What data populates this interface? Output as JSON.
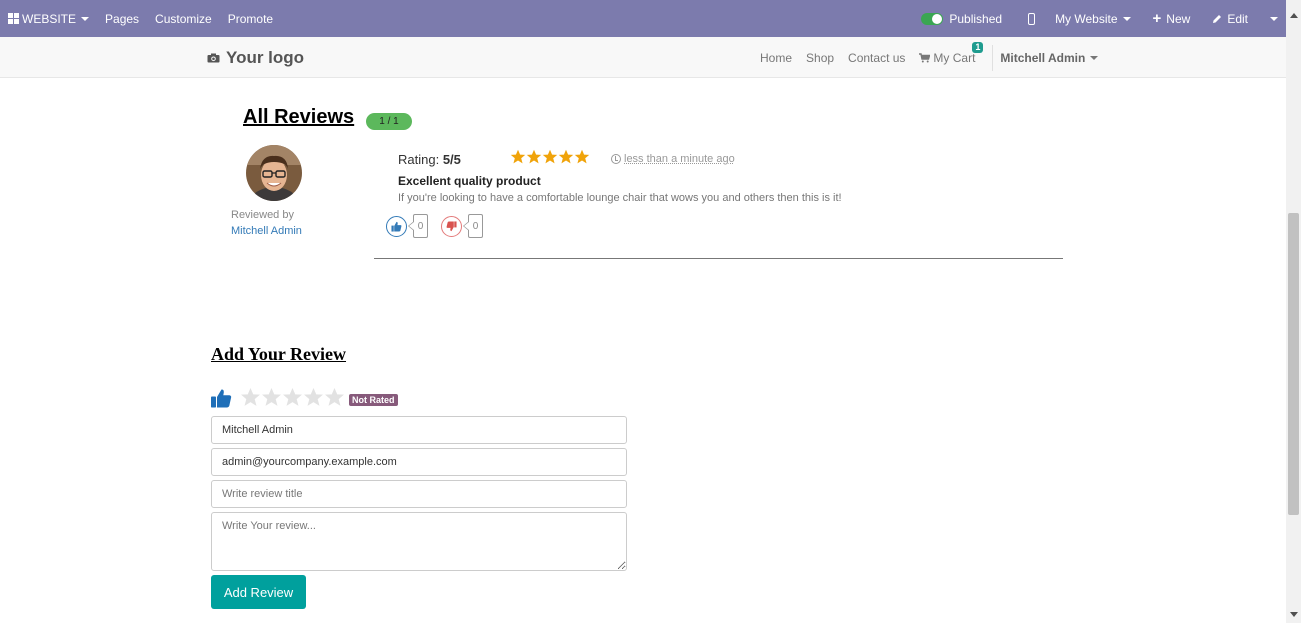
{
  "adminbar": {
    "website_label": "WEBSITE",
    "pages_label": "Pages",
    "customize_label": "Customize",
    "promote_label": "Promote",
    "published_label": "Published",
    "my_website_label": "My Website",
    "new_label": "New",
    "edit_label": "Edit",
    "color": "#7c7bad"
  },
  "header": {
    "logo_text": "Your logo",
    "nav": {
      "home": "Home",
      "shop": "Shop",
      "contact": "Contact us",
      "cart": "My Cart",
      "cart_count": "1",
      "user": "Mitchell Admin"
    }
  },
  "reviews": {
    "title": "All Reviews",
    "count_badge": "1 / 1",
    "items": [
      {
        "reviewed_by_label": "Reviewed by",
        "reviewer": "Mitchell Admin",
        "rating_label": "Rating:",
        "rating_value": "5/5",
        "stars": 5,
        "time": "less than a minute ago",
        "title": "Excellent quality product",
        "body": "If you're looking to have a comfortable lounge chair that wows you and others then this is it!",
        "likes": "0",
        "dislikes": "0"
      }
    ]
  },
  "add_review": {
    "title": "Add Your Review",
    "rating_status": "Not Rated",
    "name_value": "Mitchell Admin",
    "email_value": "admin@yourcompany.example.com",
    "title_placeholder": "Write review title",
    "review_placeholder": "Write Your review...",
    "submit_label": "Add Review",
    "button_color": "#00a09d"
  }
}
